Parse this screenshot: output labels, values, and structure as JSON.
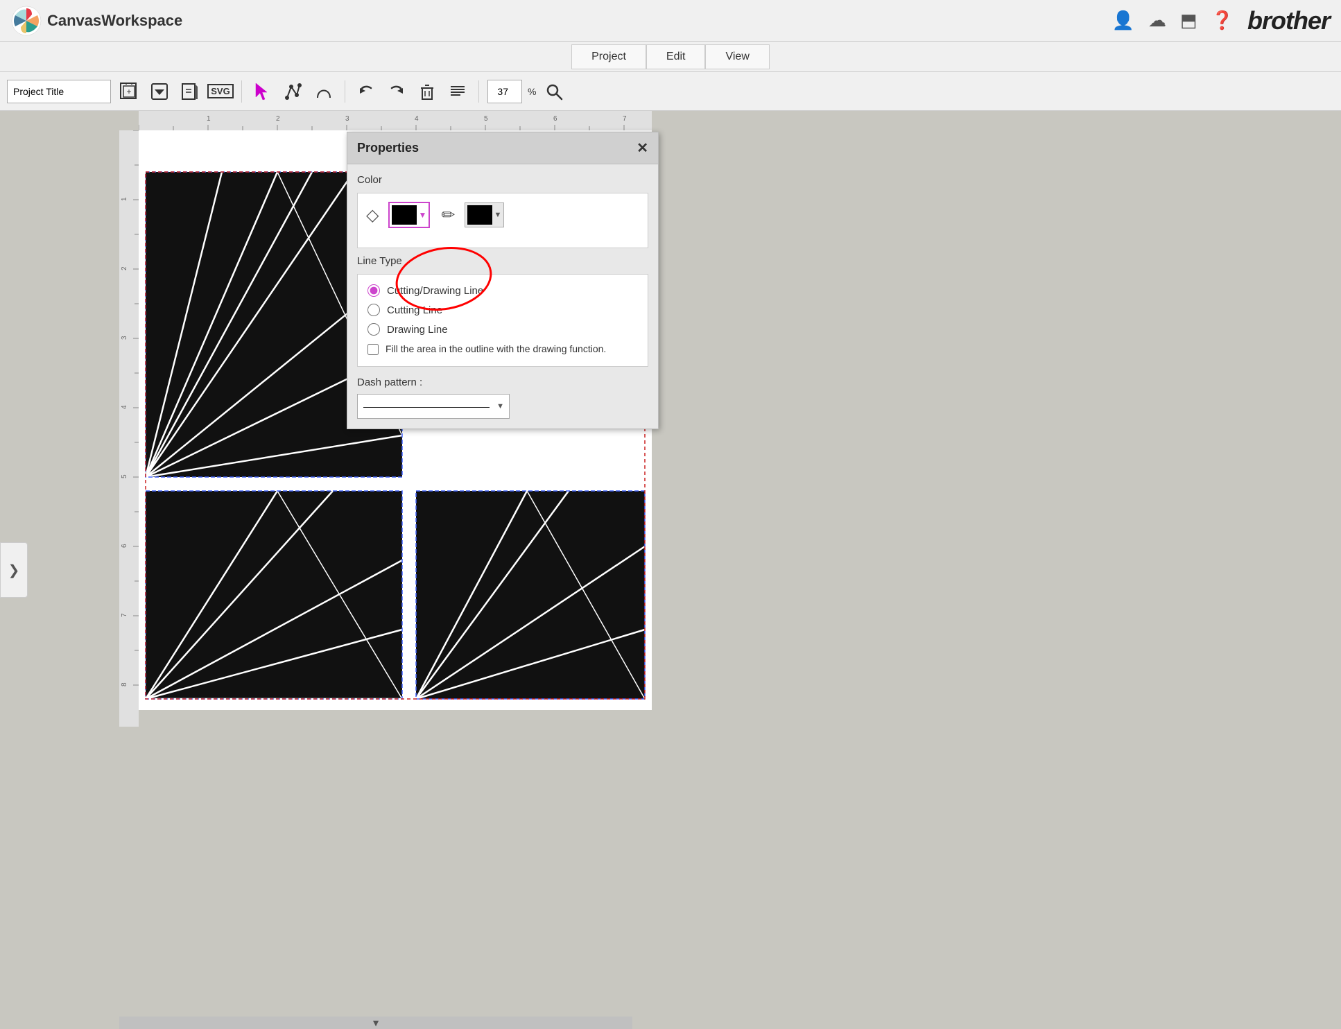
{
  "app": {
    "name": "CanvasWorkspace",
    "brother_logo": "brother"
  },
  "menu": {
    "project_label": "Project",
    "edit_label": "Edit",
    "view_label": "View"
  },
  "toolbar": {
    "project_title_placeholder": "Project Title",
    "project_title_value": "Project Title",
    "zoom_value": "37",
    "zoom_unit": "%"
  },
  "properties_panel": {
    "title": "Properties",
    "close_label": "✕",
    "color_label": "Color",
    "line_type_label": "Line Type",
    "line_type_options": [
      {
        "id": "cutting_drawing",
        "label": "Cutting/Drawing Line",
        "checked": true
      },
      {
        "id": "cutting",
        "label": "Cutting Line",
        "checked": false
      },
      {
        "id": "drawing",
        "label": "Drawing Line",
        "checked": false
      }
    ],
    "fill_checkbox_label": "Fill the area in the outline with the drawing function.",
    "dash_pattern_label": "Dash pattern :",
    "dash_pattern_value": "—————————————"
  },
  "canvas": {
    "brother_logo": "brother"
  },
  "sidebar": {
    "toggle_label": "❯"
  },
  "icons": {
    "arrow_select": "➤",
    "nodes": "⌇",
    "bezier": "↙",
    "undo": "↩",
    "redo": "↪",
    "delete": "🗑",
    "text": "☰",
    "zoom": "🔍",
    "add_canvas": "⊞",
    "save": "⬇",
    "import": "🖿",
    "svg": "SVG"
  }
}
